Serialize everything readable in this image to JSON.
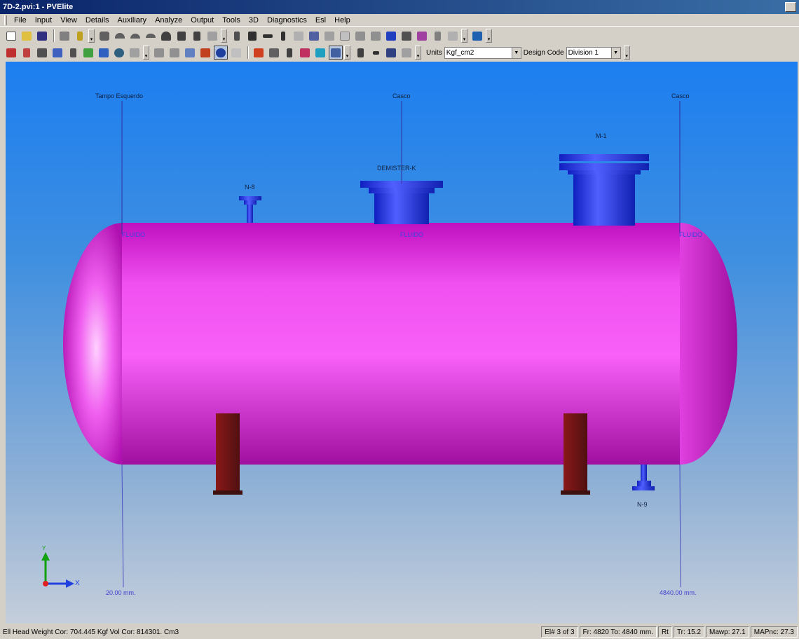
{
  "window": {
    "title": "7D-2.pvi:1 - PVElite"
  },
  "menu": [
    "File",
    "Input",
    "View",
    "Details",
    "Auxiliary",
    "Analyze",
    "Output",
    "Tools",
    "3D",
    "Diagnostics",
    "Esl",
    "Help"
  ],
  "toolbar": {
    "units_label": "Units",
    "units_value": "Kgf_cm2",
    "design_code_label": "Design Code",
    "design_code_value": "Division 1"
  },
  "viewport": {
    "labels": {
      "tampo_esquerdo": "Tampo Esquerdo",
      "casco_center": "Casco",
      "casco_right": "Casco",
      "demister": "DEMISTER-K",
      "m1": "M-1",
      "n8": "N-8",
      "n9": "N-9",
      "fluido_left": "FLUIDO",
      "fluido_center": "FLUIDO",
      "fluido_right": "FLUIDO",
      "dim_left": "20.00 mm.",
      "dim_right": "4840.00 mm.",
      "axis_x": "X",
      "axis_y": "Y"
    },
    "colors": {
      "vessel": "#e020e0",
      "nozzle": "#2030f0",
      "saddle": "#701010"
    }
  },
  "status": {
    "main": "Ell Head Weight Cor: 704.445 Kgf  Vol Cor: 814301. Cm3",
    "element": "El# 3 of 3",
    "from_to": "Fr: 4820 To: 4840 mm.",
    "rt": "Rt",
    "tr": "Tr: 15.2",
    "mawp": "Mawp: 27.1",
    "mapnc": "MAPnc: 27.3"
  }
}
